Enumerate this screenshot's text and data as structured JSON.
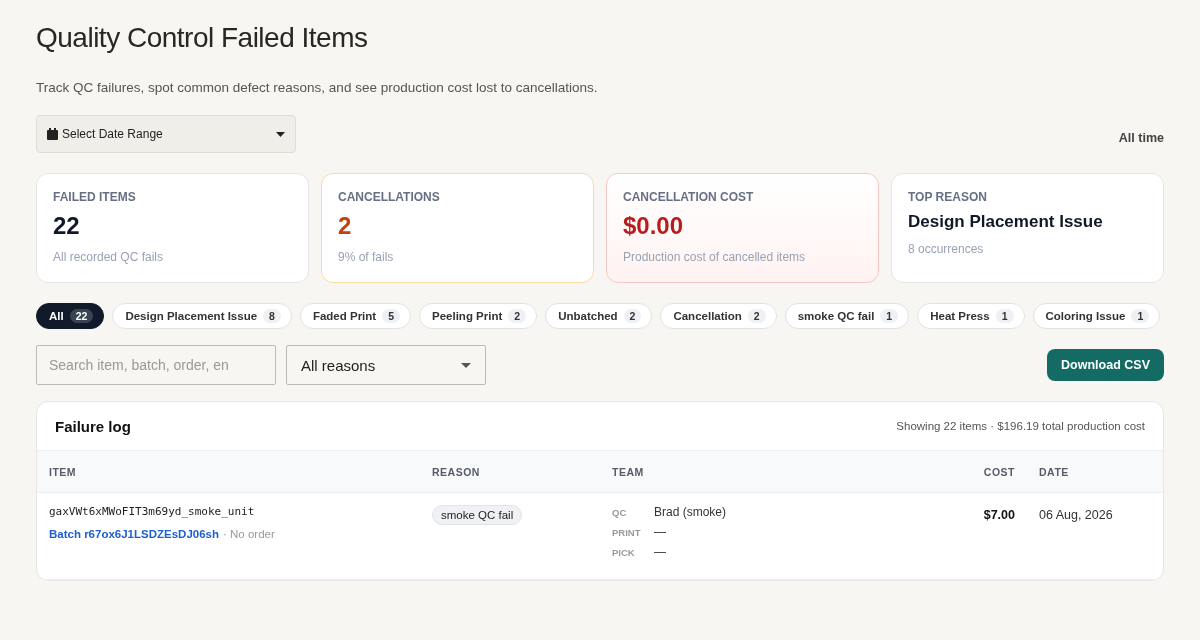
{
  "title": "Quality Control Failed Items",
  "subtitle": "Track QC failures, spot common defect reasons, and see production cost lost to cancellations.",
  "date_range": {
    "label": "Select Date Range",
    "period": "All time"
  },
  "stats": [
    {
      "kind": "neutral",
      "label": "FAILED ITEMS",
      "value": "22",
      "note": "All recorded QC fails"
    },
    {
      "kind": "warning",
      "label": "CANCELLATIONS",
      "value": "2",
      "note": "9% of fails"
    },
    {
      "kind": "danger",
      "label": "CANCELLATION COST",
      "value": "$0.00",
      "note": "Production cost of cancelled items"
    },
    {
      "kind": "text",
      "label": "TOP REASON",
      "value": "Design Placement Issue",
      "note": "8 occurrences"
    }
  ],
  "filters": [
    {
      "label": "All",
      "count": "22",
      "selected": true
    },
    {
      "label": "Design Placement Issue",
      "count": "8",
      "selected": false
    },
    {
      "label": "Faded Print",
      "count": "5",
      "selected": false
    },
    {
      "label": "Peeling Print",
      "count": "2",
      "selected": false
    },
    {
      "label": "Unbatched",
      "count": "2",
      "selected": false
    },
    {
      "label": "Cancellation",
      "count": "2",
      "selected": false
    },
    {
      "label": "smoke QC fail",
      "count": "1",
      "selected": false
    },
    {
      "label": "Heat Press",
      "count": "1",
      "selected": false
    },
    {
      "label": "Coloring Issue",
      "count": "1",
      "selected": false
    }
  ],
  "search": {
    "placeholder": "Search item, batch, order, en"
  },
  "reason_select": {
    "value": "All reasons"
  },
  "download_button": "Download CSV",
  "log": {
    "title": "Failure log",
    "summary": "Showing 22 items · $196.19 total production cost",
    "columns": [
      "ITEM",
      "REASON",
      "TEAM",
      "COST",
      "DATE"
    ],
    "rows": [
      {
        "item": "gaxVWt6xMWoFIT3m69yd_smoke_unit",
        "batch": "Batch r67ox6J1LSDZEsDJ06sh",
        "order": "· No order",
        "reason": "smoke QC fail",
        "team": [
          {
            "role": "QC",
            "name": "Brad (smoke)"
          },
          {
            "role": "PRINT",
            "name": "—"
          },
          {
            "role": "PICK",
            "name": "—"
          }
        ],
        "cost": "$7.00",
        "date": "06 Aug, 2026"
      }
    ]
  }
}
